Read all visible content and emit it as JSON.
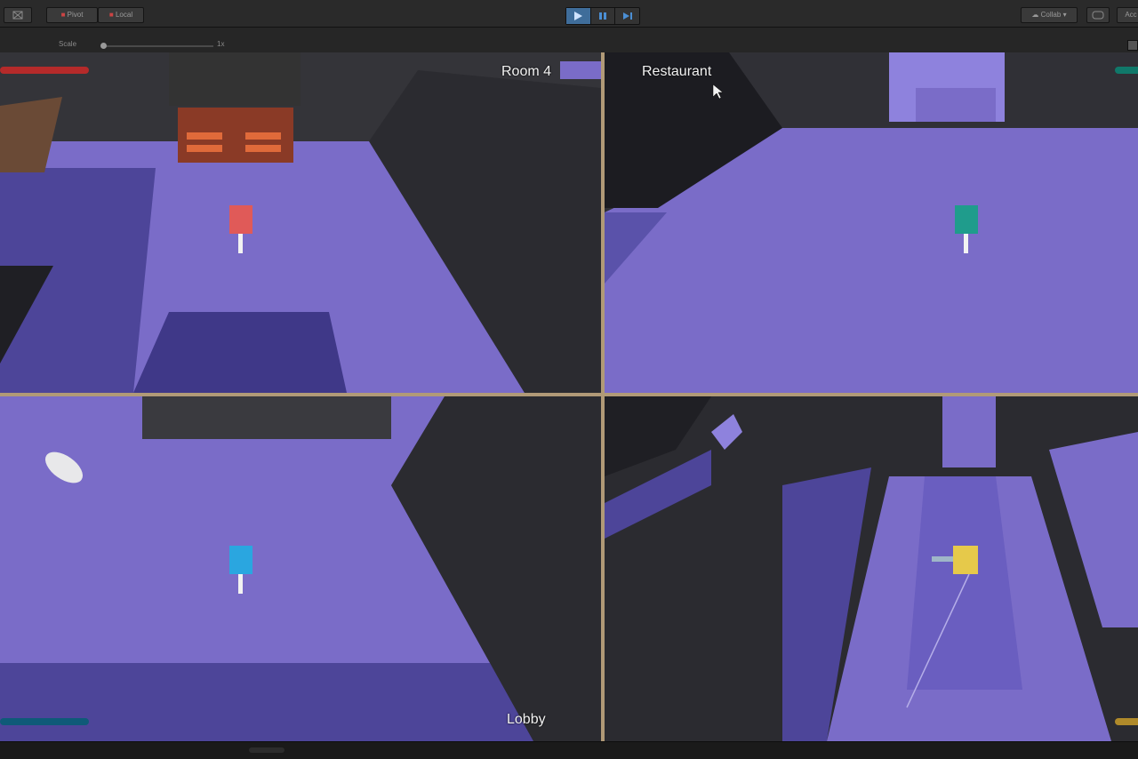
{
  "toolbar": {
    "pivot_label": "Pivot",
    "local_label": "Local",
    "collab_label": "Collab",
    "account_label": "Acc"
  },
  "scene": {
    "scale_label": "Scale",
    "scale_value": "1x"
  },
  "viewports": [
    {
      "label": "Room 4",
      "player_color": "#e05a58",
      "health_color": "#b52a2a"
    },
    {
      "label": "Restaurant",
      "player_color": "#1f9c8c",
      "health_color": "#10786a"
    },
    {
      "label": "Lobby",
      "player_color": "#2aa6e0",
      "health_color": "#0f5a78"
    },
    {
      "label": "",
      "player_color": "#e6c94a",
      "health_color": "#b08a2a"
    }
  ],
  "colors": {
    "floor": "#7a6cc8",
    "wall": "#2e2e33",
    "divider": "#b19a77"
  },
  "icons": {
    "play": "play-icon",
    "pause": "pause-icon",
    "step": "step-icon",
    "layers": "layers-icon",
    "cursor": "cursor-icon"
  }
}
